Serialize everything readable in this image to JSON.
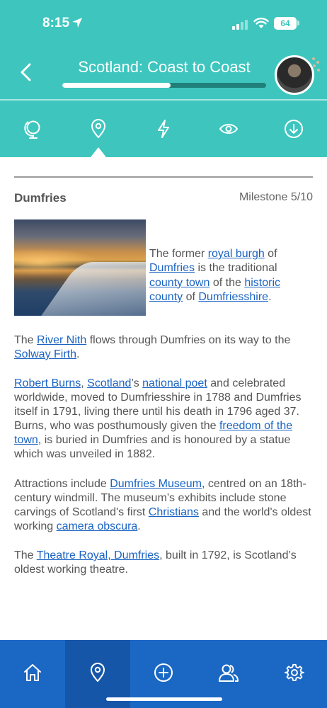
{
  "status_bar": {
    "time": "8:15",
    "battery": "64",
    "icons": [
      "location-arrow-icon",
      "signal-icon",
      "wifi-icon",
      "battery-icon"
    ]
  },
  "header": {
    "back_icon": "chevron-left-icon",
    "title": "Scotland: Coast to Coast",
    "progress_fraction": 0.53,
    "colors": {
      "background": "#3ec6be",
      "progress_track": "#1f7f79",
      "progress_fill": "#ffffff"
    }
  },
  "tabs": [
    {
      "icon": "globe-icon",
      "active": false
    },
    {
      "icon": "location-pin-icon",
      "active": true
    },
    {
      "icon": "lightning-icon",
      "active": false
    },
    {
      "icon": "eye-icon",
      "active": false
    },
    {
      "icon": "download-icon",
      "active": false
    }
  ],
  "article": {
    "place": "Dumfries",
    "milestone": "Milestone 5/10",
    "intro": {
      "t1": "The former ",
      "l1": "royal burgh",
      "t2": " of ",
      "l2": "Dumfries",
      "t3": " is the traditional ",
      "l3": "county town",
      "t4": " of the ",
      "l4": "historic county",
      "t5": " of ",
      "l5": "Dumfriesshire",
      "t6": "."
    },
    "p2": {
      "t1": "The ",
      "l1": "River Nith",
      "t2": " flows through Dumfries on its way to the ",
      "l2": "Solway Firth",
      "t3": "."
    },
    "p3": {
      "l1": "Robert Burns",
      "t1": ", ",
      "l2": "Scotland",
      "t2": "’s ",
      "l3": "national poet",
      "t3": " and celebrated worldwide, moved to Dumfriesshire in 1788 and Dumfries itself in 1791, living there until his death in 1796 aged 37. Burns, who was posthumously given the ",
      "l4": "freedom of the town",
      "t4": ", is buried in Dumfries and is honoured by a statue which was unveiled in 1882."
    },
    "p4": {
      "t1": "Attractions include ",
      "l1": "Dumfries Museum",
      "t2": ", centred on an 18th-century windmill. The museum’s exhibits include stone carvings of Scotland's first ",
      "l2": "Christians",
      "t3": " and the world's oldest working ",
      "l3": "camera obscura",
      "t4": "."
    },
    "p5": {
      "t1": "The ",
      "l1": "Theatre Royal, Dumfries",
      "t2": ", built in 1792, is Scotland’s oldest working theatre."
    }
  },
  "bottom_nav": {
    "items": [
      {
        "icon": "home-icon",
        "active": false
      },
      {
        "icon": "location-pin-icon",
        "active": true
      },
      {
        "icon": "plus-circle-icon",
        "active": false
      },
      {
        "icon": "people-icon",
        "active": false
      },
      {
        "icon": "gear-icon",
        "active": false
      }
    ],
    "colors": {
      "background": "#1b68c4",
      "active": "#1656a9",
      "link": "#1a63c2"
    }
  }
}
